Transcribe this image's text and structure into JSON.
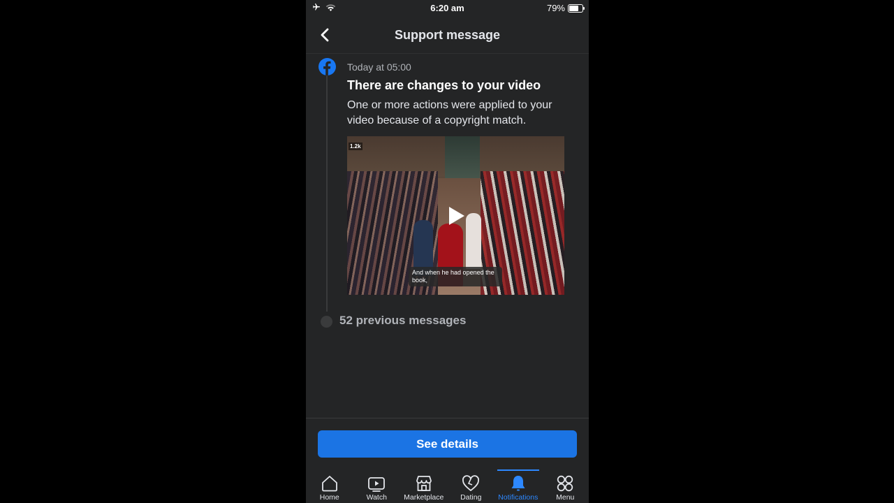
{
  "status_bar": {
    "time": "6:20 am",
    "battery_percent": "79%",
    "battery_level": 0.79,
    "icons": [
      "airplane-icon",
      "wifi-icon",
      "battery-icon"
    ]
  },
  "header": {
    "title": "Support message",
    "back_icon": "chevron-left-icon"
  },
  "message": {
    "sender_icon": "facebook-icon",
    "timestamp": "Today at 05:00",
    "title": "There are changes to your video",
    "body": "One or more actions were applied to your video because of a copyright match.",
    "video": {
      "view_count": "1.2k",
      "caption": "And when he had opened the book,",
      "play_icon": "play-icon"
    }
  },
  "previous_messages": {
    "label": "52 previous messages"
  },
  "action_button": {
    "label": "See details",
    "color": "#1b74e4"
  },
  "tab_bar": {
    "active_color": "#2d88ff",
    "items": [
      {
        "label": "Home",
        "icon": "home-icon",
        "active": false
      },
      {
        "label": "Watch",
        "icon": "watch-icon",
        "active": false
      },
      {
        "label": "Marketplace",
        "icon": "marketplace-icon",
        "active": false
      },
      {
        "label": "Dating",
        "icon": "dating-icon",
        "active": false
      },
      {
        "label": "Notifications",
        "icon": "bell-icon",
        "active": true
      },
      {
        "label": "Menu",
        "icon": "menu-icon",
        "active": false
      }
    ]
  }
}
